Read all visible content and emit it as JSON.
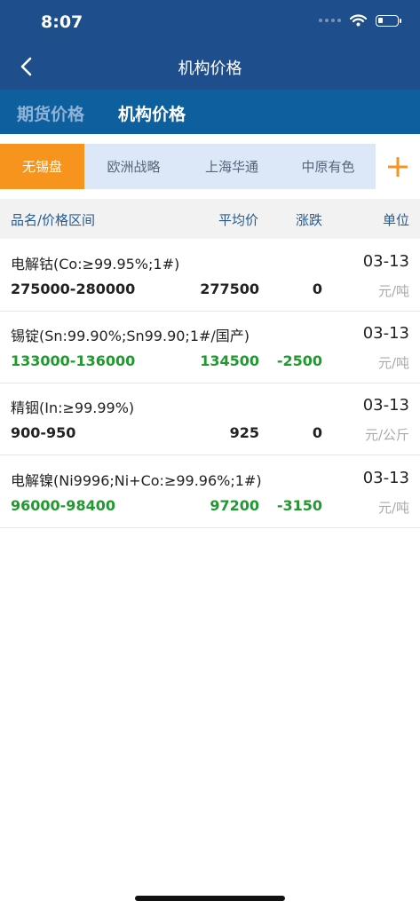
{
  "status": {
    "time": "8:07"
  },
  "nav": {
    "title": "机构价格"
  },
  "top_tabs": [
    {
      "label": "期货价格",
      "active": false
    },
    {
      "label": "机构价格",
      "active": true
    }
  ],
  "org_tabs": [
    {
      "label": "无锡盘",
      "selected": true
    },
    {
      "label": "欧洲战略",
      "selected": false
    },
    {
      "label": "上海华通",
      "selected": false
    },
    {
      "label": "中原有色",
      "selected": false
    }
  ],
  "plus_icon": "plus-icon",
  "accent_color": "#f7941d",
  "up_color": "#1f9a2e",
  "table": {
    "headers": {
      "name": "品名/价格区间",
      "avg": "平均价",
      "change": "涨跌",
      "unit": "单位"
    },
    "rows": [
      {
        "name": "电解钴(Co:≥99.95%;1#)",
        "date": "03-13",
        "range": "275000-280000",
        "avg": "277500",
        "change": "0",
        "unit": "元/吨",
        "color": "black"
      },
      {
        "name": "锡锭(Sn:99.90%;Sn99.90;1#/国产)",
        "date": "03-13",
        "range": "133000-136000",
        "avg": "134500",
        "change": "-2500",
        "unit": "元/吨",
        "color": "green"
      },
      {
        "name": "精铟(In:≥99.99%)",
        "date": "03-13",
        "range": "900-950",
        "avg": "925",
        "change": "0",
        "unit": "元/公斤",
        "color": "black"
      },
      {
        "name": "电解镍(Ni9996;Ni+Co:≥99.96%;1#)",
        "date": "03-13",
        "range": "96000-98400",
        "avg": "97200",
        "change": "-3150",
        "unit": "元/吨",
        "color": "green"
      }
    ]
  }
}
